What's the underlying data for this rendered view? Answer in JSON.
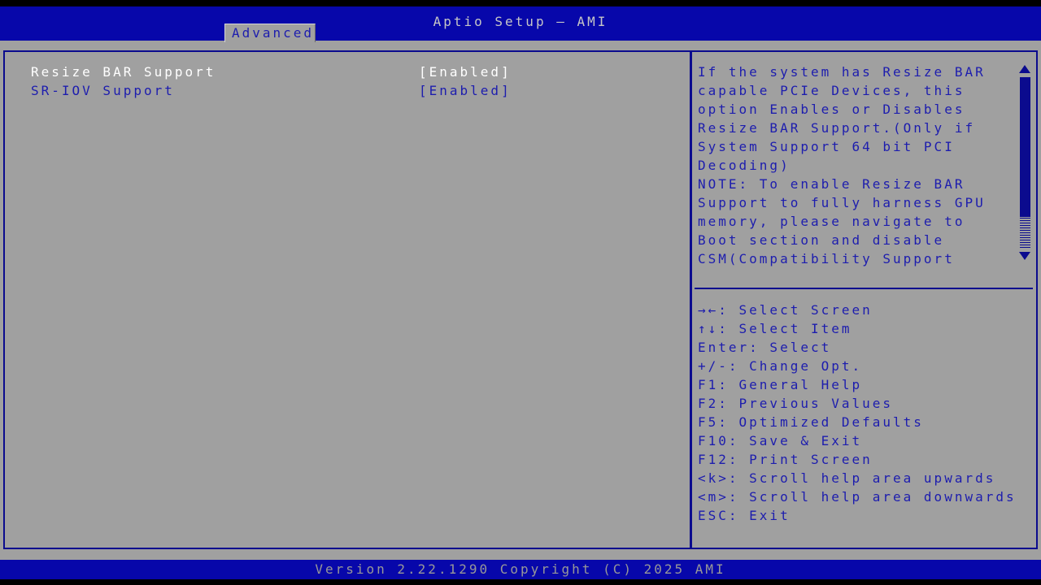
{
  "colors": {
    "header_blue": "#0707aa",
    "panel_gray": "#a0a0a0",
    "text_blue": "#1d1dae",
    "border_navy": "#0b0b8e",
    "highlight_white": "#ffffff",
    "title_gray": "#c6c6c6",
    "footer_text_gray": "#989898"
  },
  "header": {
    "title": "Aptio Setup – AMI",
    "tab": "Advanced"
  },
  "options": [
    {
      "label": "Resize BAR Support",
      "value": "[Enabled]",
      "highlighted": true
    },
    {
      "label": "SR-IOV Support",
      "value": "[Enabled]",
      "highlighted": false
    }
  ],
  "help_panel": {
    "lines": [
      "If the system has Resize BAR",
      "capable PCIe Devices, this",
      "option Enables or Disables",
      "Resize BAR Support.(Only if",
      "System Support 64 bit PCI",
      "Decoding)",
      "NOTE: To enable Resize BAR",
      "Support to fully harness GPU",
      "memory, please navigate to",
      "Boot section and disable",
      "CSM(Compatibility Support"
    ]
  },
  "legend": {
    "lines": [
      "→←: Select Screen",
      "↑↓: Select Item",
      "Enter: Select",
      "+/-: Change Opt.",
      "F1: General Help",
      "F2: Previous Values",
      "F5: Optimized Defaults",
      "F10: Save & Exit",
      "F12: Print Screen",
      "<k>: Scroll help area upwards",
      "<m>: Scroll help area downwards",
      "ESC: Exit"
    ]
  },
  "scrollbar": {
    "up_icon": "scrollbar-up-arrow",
    "down_icon": "scrollbar-down-arrow"
  },
  "footer": {
    "version_text": "Version 2.22.1290 Copyright (C) 2025 AMI"
  }
}
